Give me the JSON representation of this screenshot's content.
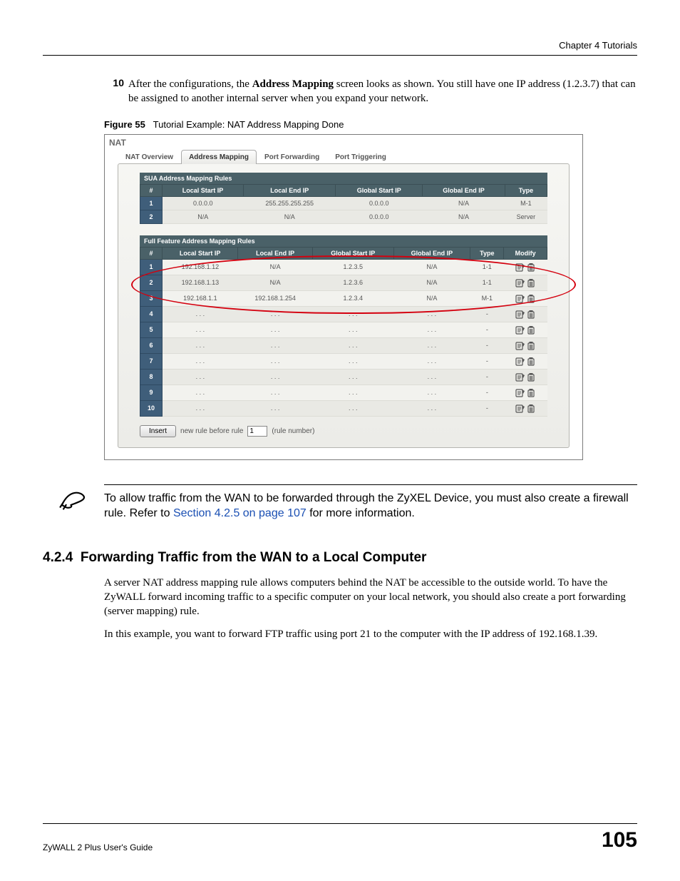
{
  "header": {
    "chapter": "Chapter 4 Tutorials"
  },
  "step": {
    "num": "10",
    "prefix": "After the configurations, the ",
    "bold1": "Address Mapping",
    "rest": " screen looks as shown. You still have one IP address (1.2.3.7) that can be assigned to another internal server when you expand your network."
  },
  "figure": {
    "label": "Figure 55",
    "caption": "Tutorial Example: NAT Address Mapping Done"
  },
  "screenshot": {
    "title": "NAT",
    "tabs": [
      "NAT Overview",
      "Address Mapping",
      "Port Forwarding",
      "Port Triggering"
    ],
    "active_tab": 1,
    "sua_header": "SUA Address Mapping Rules",
    "full_header": "Full Feature Address Mapping Rules",
    "cols_basic": [
      "#",
      "Local Start IP",
      "Local End IP",
      "Global Start IP",
      "Global End IP",
      "Type"
    ],
    "cols_full": [
      "#",
      "Local Start IP",
      "Local End IP",
      "Global Start IP",
      "Global End IP",
      "Type",
      "Modify"
    ],
    "sua_rows": [
      {
        "n": "1",
        "ls": "0.0.0.0",
        "le": "255.255.255.255",
        "gs": "0.0.0.0",
        "ge": "N/A",
        "t": "M-1"
      },
      {
        "n": "2",
        "ls": "N/A",
        "le": "N/A",
        "gs": "0.0.0.0",
        "ge": "N/A",
        "t": "Server"
      }
    ],
    "full_rows": [
      {
        "n": "1",
        "ls": "192.168.1.12",
        "le": "N/A",
        "gs": "1.2.3.5",
        "ge": "N/A",
        "t": "1-1"
      },
      {
        "n": "2",
        "ls": "192.168.1.13",
        "le": "N/A",
        "gs": "1.2.3.6",
        "ge": "N/A",
        "t": "1-1"
      },
      {
        "n": "3",
        "ls": "192.168.1.1",
        "le": "192.168.1.254",
        "gs": "1.2.3.4",
        "ge": "N/A",
        "t": "M-1"
      },
      {
        "n": "4",
        "ls": ". . .",
        "le": ". . .",
        "gs": ". . .",
        "ge": ". . .",
        "t": "-"
      },
      {
        "n": "5",
        "ls": ". . .",
        "le": ". . .",
        "gs": ". . .",
        "ge": ". . .",
        "t": "-"
      },
      {
        "n": "6",
        "ls": ". . .",
        "le": ". . .",
        "gs": ". . .",
        "ge": ". . .",
        "t": "-"
      },
      {
        "n": "7",
        "ls": ". . .",
        "le": ". . .",
        "gs": ". . .",
        "ge": ". . .",
        "t": "-"
      },
      {
        "n": "8",
        "ls": ". . .",
        "le": ". . .",
        "gs": ". . .",
        "ge": ". . .",
        "t": "-"
      },
      {
        "n": "9",
        "ls": ". . .",
        "le": ". . .",
        "gs": ". . .",
        "ge": ". . .",
        "t": "-"
      },
      {
        "n": "10",
        "ls": ". . .",
        "le": ". . .",
        "gs": ". . .",
        "ge": ". . .",
        "t": "-"
      }
    ],
    "insert": {
      "button": "Insert",
      "before": "new rule before rule",
      "value": "1",
      "after": "(rule number)"
    }
  },
  "note": {
    "text_before": "To allow traffic from the WAN to be forwarded through the ZyXEL Device, you must also create a firewall rule. Refer to ",
    "link": "Section 4.2.5 on page 107",
    "text_after": " for more information."
  },
  "subsection": {
    "number": "4.2.4",
    "title": "Forwarding Traffic from the WAN to a Local Computer"
  },
  "para1": "A server NAT address mapping rule allows computers behind the NAT be accessible to the outside world. To have the ZyWALL forward incoming traffic to a specific computer on your local network, you should also create a port forwarding (server mapping) rule.",
  "para2": "In this example, you want to forward FTP traffic using port 21 to the computer with the IP address of 192.168.1.39.",
  "footer": {
    "guide": "ZyWALL 2 Plus User's Guide",
    "page": "105"
  }
}
